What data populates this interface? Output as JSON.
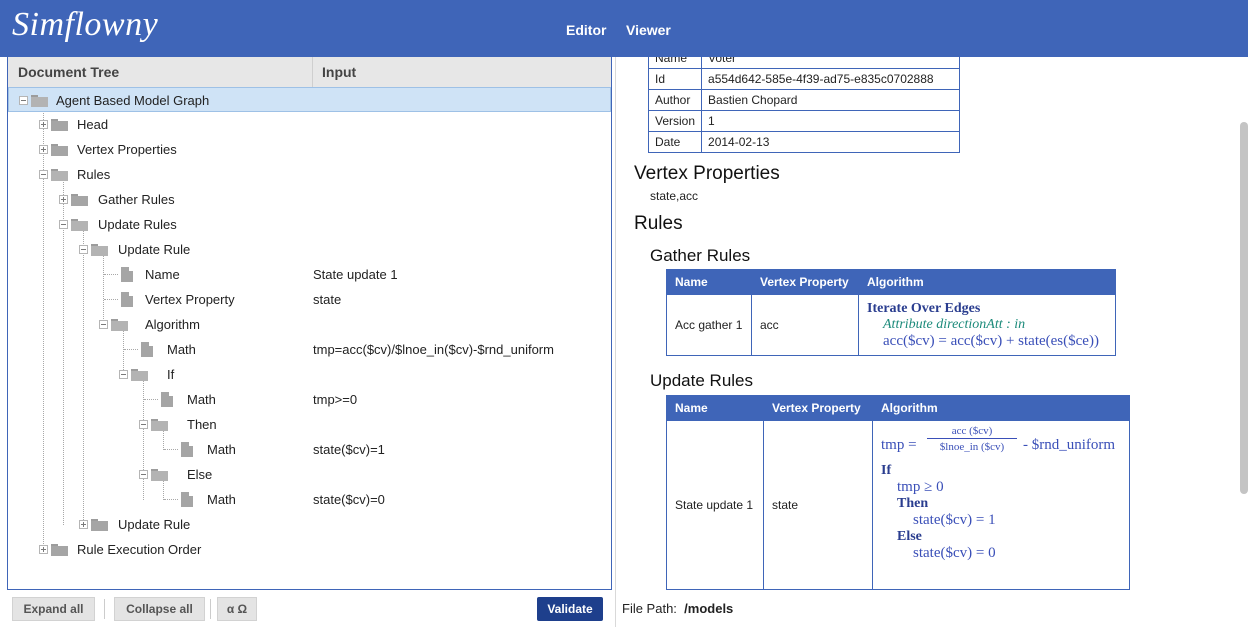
{
  "app": {
    "logo": "Simflowny"
  },
  "nav": {
    "editor": "Editor",
    "viewer": "Viewer"
  },
  "tree_header": {
    "document_tree": "Document Tree",
    "input": "Input"
  },
  "tree": {
    "root": "Agent Based Model Graph",
    "head": "Head",
    "vertex_properties": "Vertex Properties",
    "rules": "Rules",
    "gather_rules": "Gather Rules",
    "update_rules": "Update Rules",
    "update_rule": "Update Rule",
    "name": "Name",
    "name_value": "State update 1",
    "vertex_property": "Vertex Property",
    "vertex_property_value": "state",
    "algorithm": "Algorithm",
    "math1": "Math",
    "math1_value": "tmp=acc($cv)/$lnoe_in($cv)-$rnd_uniform",
    "if": "If",
    "math2": "Math",
    "math2_value": "tmp>=0",
    "then": "Then",
    "math3": "Math",
    "math3_value": "state($cv)=1",
    "else": "Else",
    "math4": "Math",
    "math4_value": "state($cv)=0",
    "update_rule2": "Update Rule",
    "rule_execution_order": "Rule Execution Order"
  },
  "toolbar": {
    "expand_all": "Expand all",
    "collapse_all": "Collapse all",
    "symbols": "α Ω",
    "validate": "Validate"
  },
  "viewer": {
    "meta": [
      {
        "key": "Name",
        "value": "Voter"
      },
      {
        "key": "Id",
        "value": "a554d642-585e-4f39-ad75-e835c0702888"
      },
      {
        "key": "Author",
        "value": "Bastien Chopard"
      },
      {
        "key": "Version",
        "value": "1"
      },
      {
        "key": "Date",
        "value": "2014-02-13"
      }
    ],
    "vertex_properties_heading": "Vertex Properties",
    "vertex_properties_value": "state,acc",
    "rules_heading": "Rules",
    "gather_heading": "Gather Rules",
    "gather_columns": {
      "name": "Name",
      "vertex_property": "Vertex Property",
      "algorithm": "Algorithm"
    },
    "gather_row": {
      "name": "Acc gather 1",
      "vertex_property": "acc",
      "algo_title": "Iterate Over Edges",
      "algo_attr": "Attribute directionAtt : in",
      "algo_expr": "acc($cv) = acc($cv) + state(es($ce))"
    },
    "update_heading": "Update Rules",
    "update_columns": {
      "name": "Name",
      "vertex_property": "Vertex Property",
      "algorithm": "Algorithm"
    },
    "update_row": {
      "name": "State update 1",
      "vertex_property": "state",
      "tmp_lhs": "tmp =",
      "frac_num": "acc ($cv)",
      "frac_den": "$lnoe_in ($cv)",
      "tmp_rest": "- $rnd_uniform",
      "if": "If",
      "cond": "tmp ≥ 0",
      "then": "Then",
      "then_expr": "state($cv) = 1",
      "else": "Else",
      "else_expr": "state($cv) = 0"
    }
  },
  "file_path": {
    "label": "File Path:",
    "value": "/models"
  }
}
